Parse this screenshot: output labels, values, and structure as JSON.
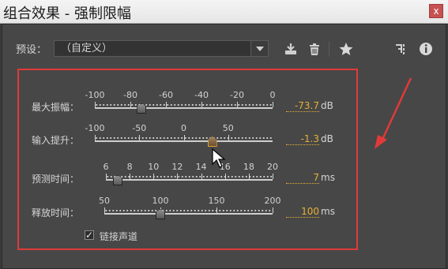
{
  "window": {
    "title": "组合效果 - 强制限幅",
    "close_label": "x"
  },
  "preset": {
    "label": "预设：",
    "value": "（自定义）"
  },
  "toolbar_icons": [
    "download-icon",
    "trash-icon",
    "star-icon",
    "routing-icon",
    "info-icon"
  ],
  "sliders": [
    {
      "name": "max-amplitude",
      "label": "最大振幅：",
      "ticks": [
        "-100",
        "-80",
        "-60",
        "-40",
        "-20",
        "0"
      ],
      "value": "-73.7",
      "unit": "dB"
    },
    {
      "name": "input-boost",
      "label": "输入提升：",
      "ticks": [
        "-100",
        "-50",
        "0",
        "50"
      ],
      "value": "-1.3",
      "unit": "dB"
    },
    {
      "name": "look-ahead-time",
      "label": "预测时间：",
      "ticks": [
        "6",
        "8",
        "10",
        "12",
        "14",
        "16",
        "18",
        "20"
      ],
      "value": "7",
      "unit": "ms"
    },
    {
      "name": "release-time",
      "label": "释放时间：",
      "ticks": [
        "50",
        "100",
        "150",
        "200"
      ],
      "value": "100",
      "unit": "ms"
    }
  ],
  "link_channels": {
    "label": "链接声道",
    "checked": true,
    "mark": "✓"
  },
  "colors": {
    "value_text": "#e6b135",
    "highlight_box": "#e03a3a",
    "panel_bg": "#474747"
  }
}
